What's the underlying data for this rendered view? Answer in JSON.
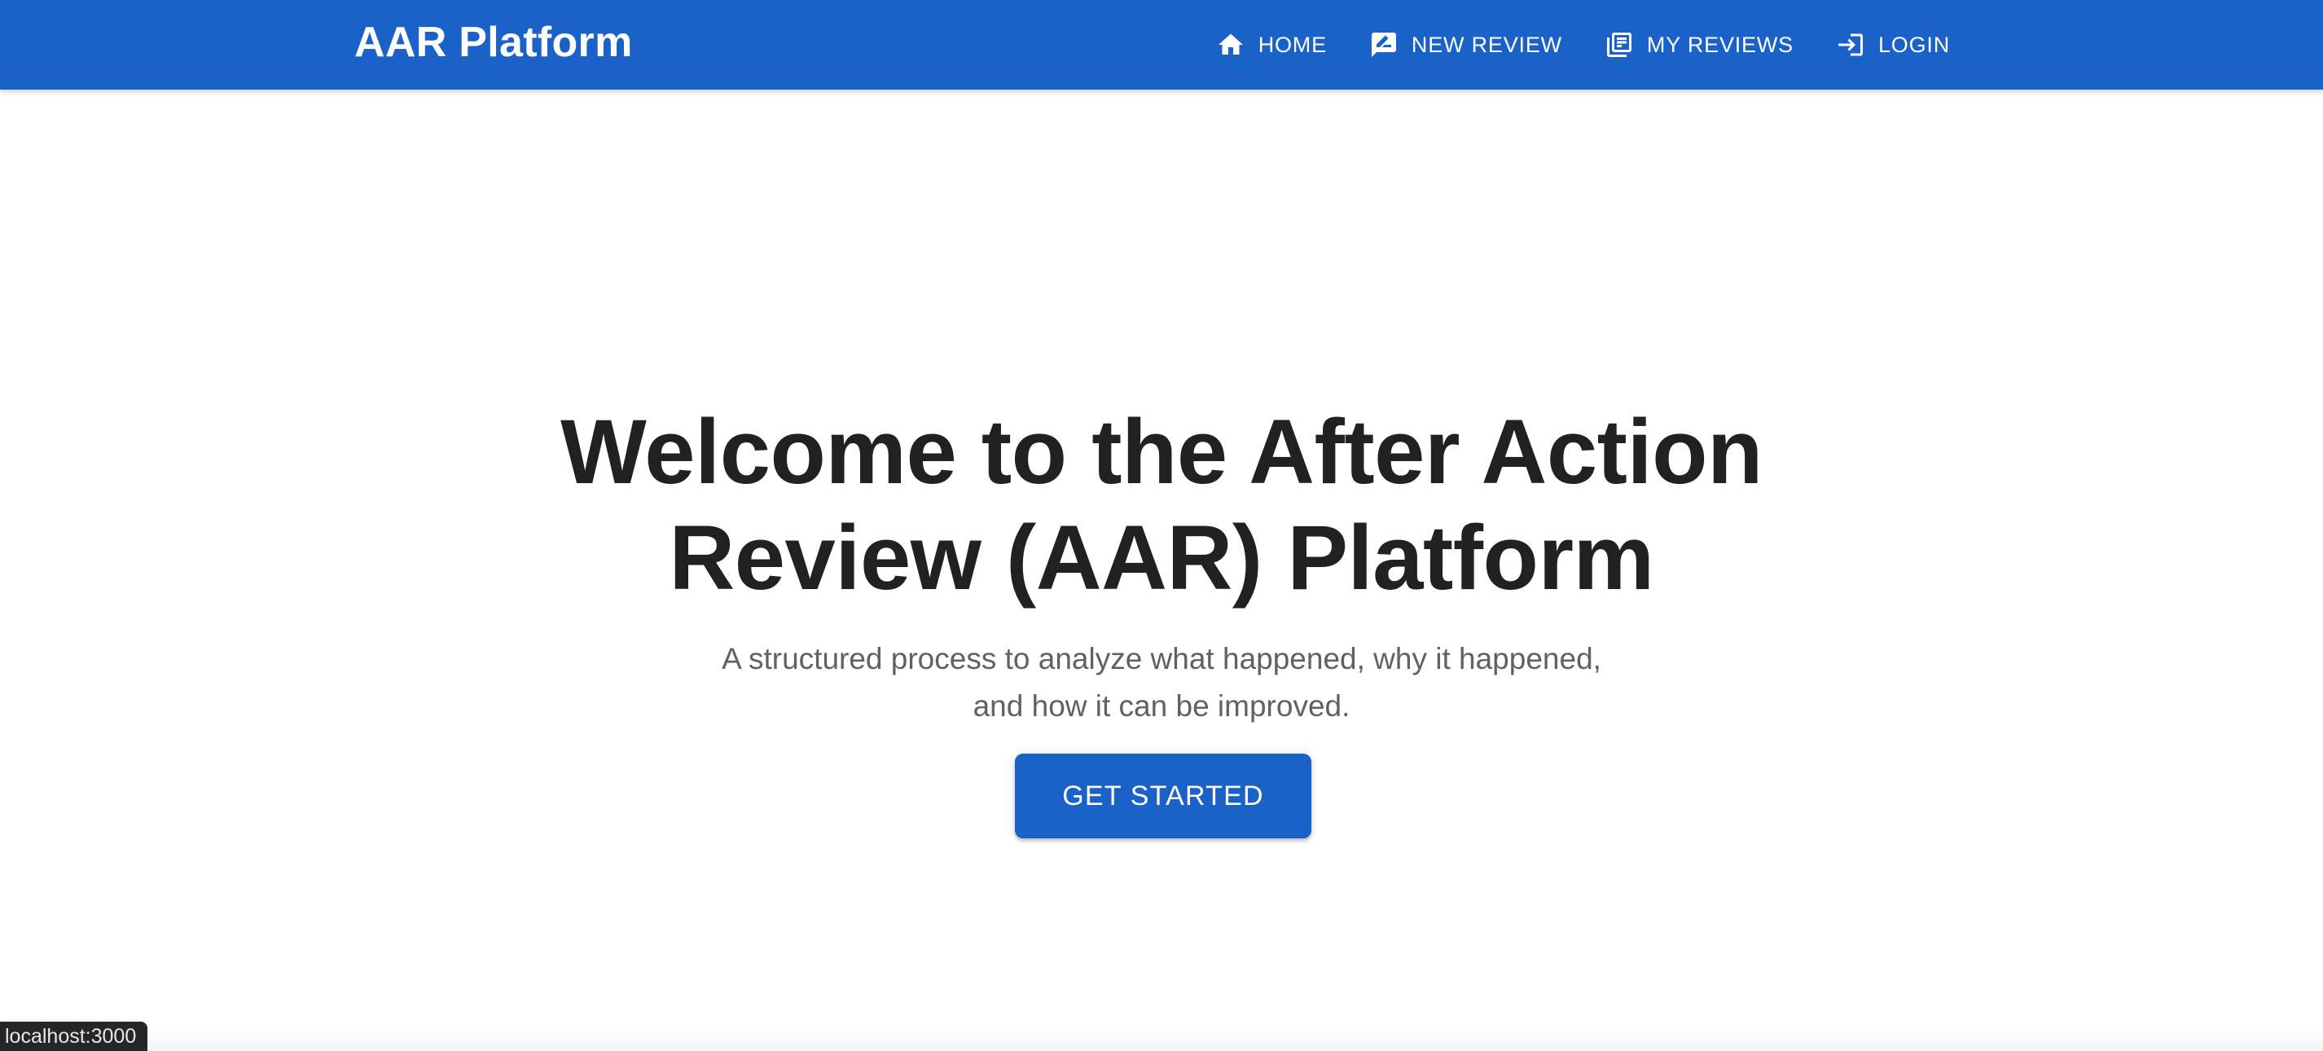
{
  "header": {
    "brand": "AAR Platform",
    "nav": [
      {
        "label": "HOME",
        "icon": "home-icon"
      },
      {
        "label": "NEW REVIEW",
        "icon": "rate-review-icon"
      },
      {
        "label": "MY REVIEWS",
        "icon": "library-books-icon"
      },
      {
        "label": "LOGIN",
        "icon": "login-icon"
      }
    ]
  },
  "hero": {
    "title_line1": "Welcome to the After Action",
    "title_line2": "Review (AAR) Platform",
    "subtitle_line1": "A structured process to analyze what happened, why it happened,",
    "subtitle_line2": "and how it can be improved.",
    "cta_label": "GET STARTED"
  },
  "status_bar": {
    "url": "localhost:3000"
  },
  "colors": {
    "primary": "#1a62c8",
    "heading": "#212121",
    "subtitle": "#616161",
    "background": "#ffffff"
  }
}
